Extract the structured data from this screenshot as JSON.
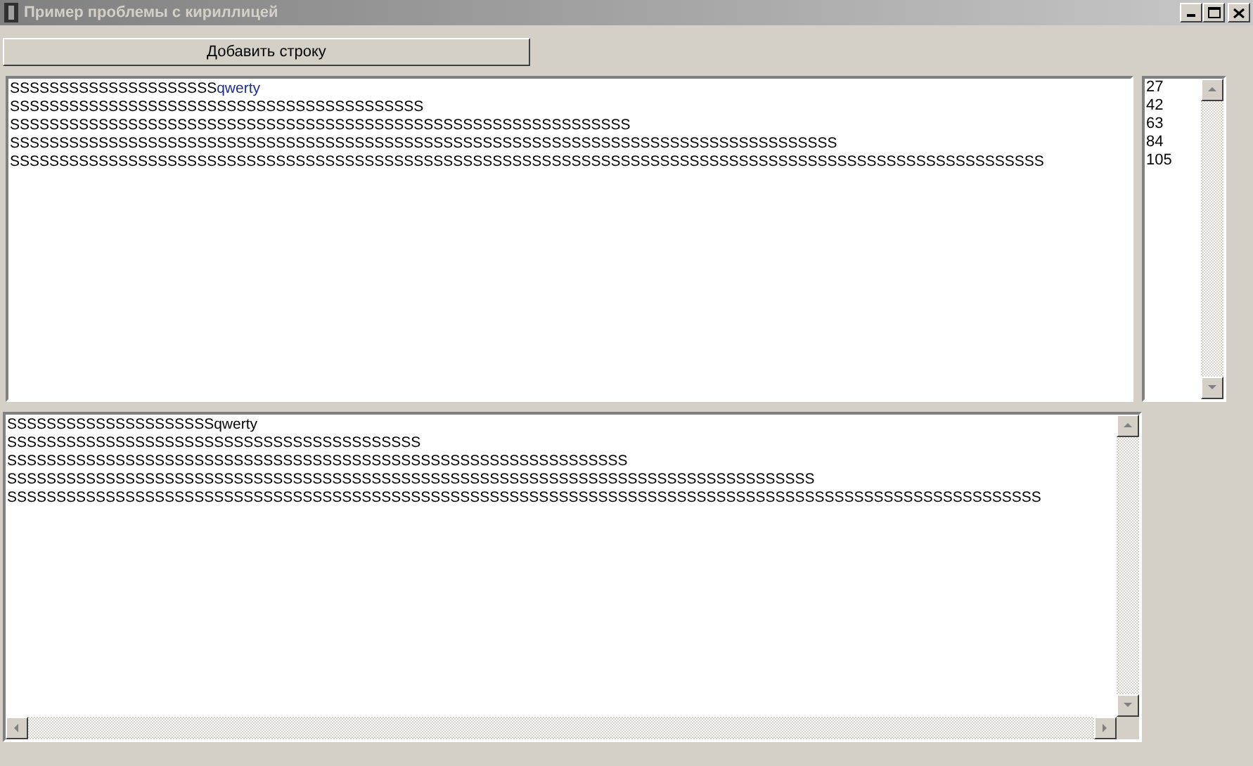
{
  "window": {
    "title": "Пример проблемы с кириллицей"
  },
  "add_button": {
    "label": "Добавить строку"
  },
  "editor_top": {
    "lines": [
      {
        "segments": [
          {
            "text": "SSSSSSSSSSSSSSSSSSSSS",
            "color": "#000000"
          },
          {
            "text": "qwerty",
            "color": "#1c2f8c"
          }
        ]
      },
      {
        "segments": [
          {
            "text": "SSSSSSSSSSSSSSSSSSSSSSSSSSSSSSSSSSSSSSSSSS",
            "color": "#000000"
          }
        ]
      },
      {
        "segments": [
          {
            "text": "SSSSSSSSSSSSSSSSSSSSSSSSSSSSSSSSSSSSSSSSSSSSSSSSSSSSSSSSSSSSSSS",
            "color": "#000000"
          }
        ]
      },
      {
        "segments": [
          {
            "text": "SSSSSSSSSSSSSSSSSSSSSSSSSSSSSSSSSSSSSSSSSSSSSSSSSSSSSSSSSSSSSSSSSSSSSSSSSSSSSSSSSSSS",
            "color": "#000000"
          }
        ]
      },
      {
        "segments": [
          {
            "text": "SSSSSSSSSSSSSSSSSSSSSSSSSSSSSSSSSSSSSSSSSSSSSSSSSSSSSSSSSSSSSSSSSSSSSSSSSSSSSSSSSSSSSSSSSSSSSSSSSSSSSSSSS",
            "color": "#000000"
          }
        ]
      }
    ]
  },
  "length_list": {
    "items": [
      "27",
      "42",
      "63",
      "84",
      "105"
    ]
  },
  "editor_bottom": {
    "lines": [
      "SSSSSSSSSSSSSSSSSSSSSqwerty",
      "SSSSSSSSSSSSSSSSSSSSSSSSSSSSSSSSSSSSSSSSSS",
      "SSSSSSSSSSSSSSSSSSSSSSSSSSSSSSSSSSSSSSSSSSSSSSSSSSSSSSSSSSSSSSS",
      "SSSSSSSSSSSSSSSSSSSSSSSSSSSSSSSSSSSSSSSSSSSSSSSSSSSSSSSSSSSSSSSSSSSSSSSSSSSSSSSSSS",
      "SSSSSSSSSSSSSSSSSSSSSSSSSSSSSSSSSSSSSSSSSSSSSSSSSSSSSSSSSSSSSSSSSSSSSSSSSSSSSSSSSSSSSSSSSSSSSSSSSSSSSSSSS"
    ]
  }
}
